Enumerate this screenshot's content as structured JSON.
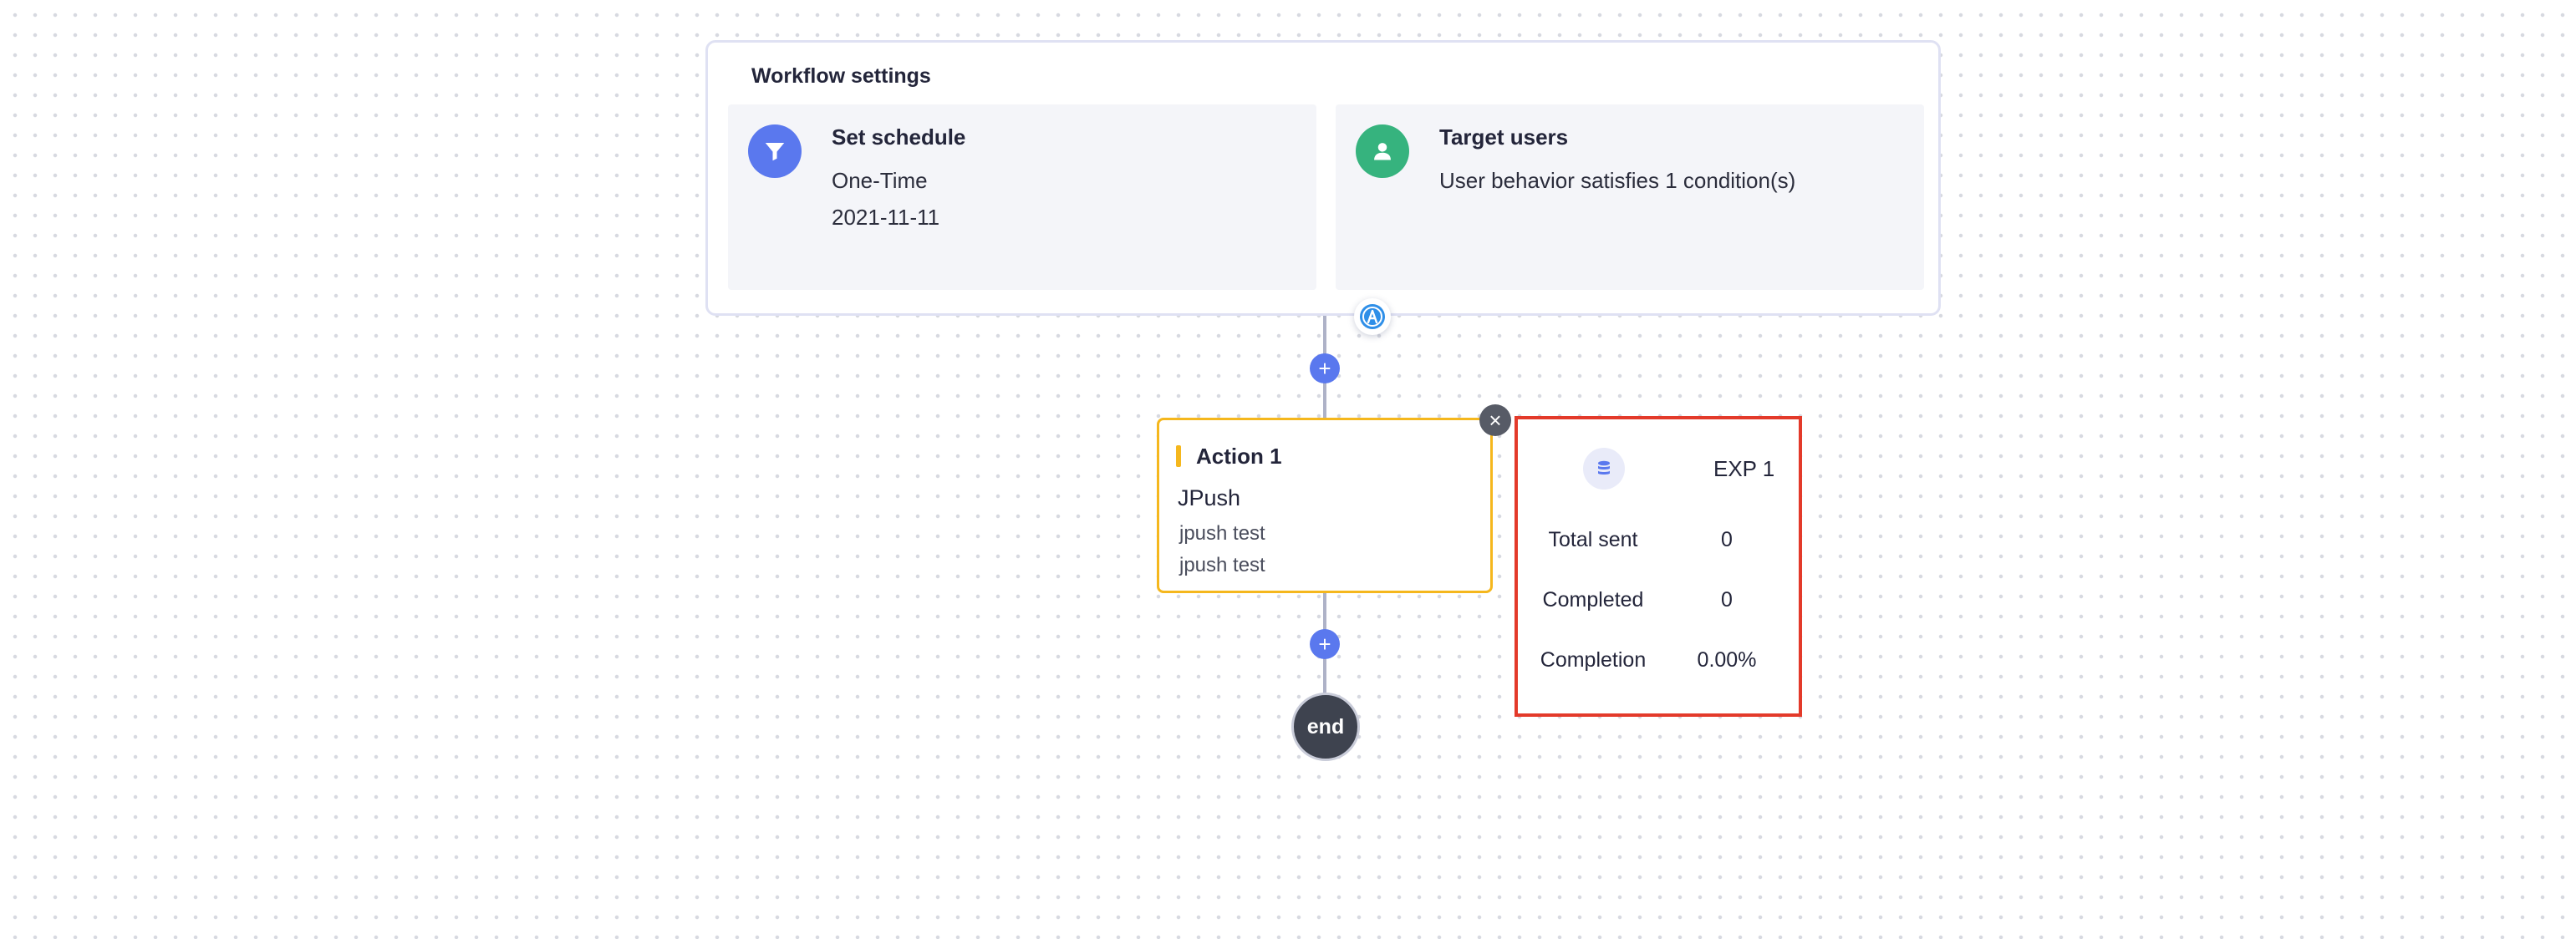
{
  "workflow_settings": {
    "title": "Workflow settings",
    "schedule": {
      "heading": "Set schedule",
      "type": "One-Time",
      "date": "2021-11-11",
      "icon": "filter-icon"
    },
    "target": {
      "heading": "Target users",
      "description": "User behavior satisfies 1 condition(s)",
      "icon": "user-icon"
    },
    "badge_icon": "a-badge-icon"
  },
  "action": {
    "title": "Action 1",
    "channel": "JPush",
    "line1": "jpush test",
    "line2": "jpush test"
  },
  "add_button_label": "+",
  "close_button_label": "×",
  "end_node": {
    "label": "end"
  },
  "experiment": {
    "name": "EXP 1",
    "icon": "database-icon",
    "stats": [
      {
        "label": "Total sent",
        "value": "0"
      },
      {
        "label": "Completed",
        "value": "0"
      },
      {
        "label": "Completion",
        "value": "0.00%"
      }
    ]
  },
  "colors": {
    "accent_blue": "#5a78ee",
    "accent_green": "#36b37e",
    "action_border": "#f5b71d",
    "highlight_red": "#e33a2a",
    "end_node": "#3e434f"
  }
}
